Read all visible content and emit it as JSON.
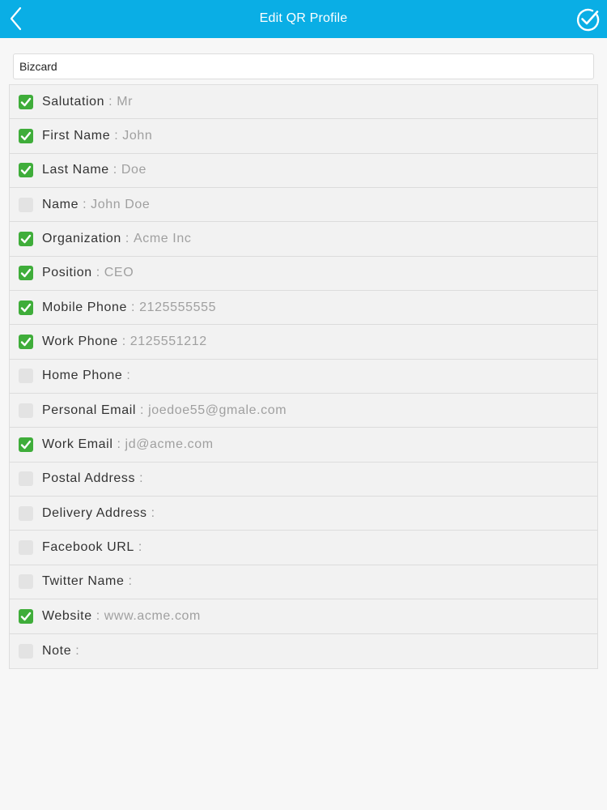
{
  "header": {
    "title": "Edit QR Profile",
    "back_icon": "chevron-left-icon",
    "done_icon": "check-circle-icon"
  },
  "profile_name": {
    "value": "Bizcard"
  },
  "colors": {
    "header": "#0aaee5",
    "checked": "#3fad3a",
    "unchecked": "#e3e3e3"
  },
  "fields": [
    {
      "label": "Salutation",
      "separator": ":",
      "value": "Mr",
      "checked": true
    },
    {
      "label": "First Name",
      "separator": ":",
      "value": "John",
      "checked": true
    },
    {
      "label": "Last Name",
      "separator": ":",
      "value": "Doe",
      "checked": true
    },
    {
      "label": "Name",
      "separator": ":",
      "value": "John Doe",
      "checked": false
    },
    {
      "label": "Organization",
      "separator": ":",
      "value": "Acme Inc",
      "checked": true
    },
    {
      "label": "Position",
      "separator": ":",
      "value": "CEO",
      "checked": true
    },
    {
      "label": "Mobile Phone",
      "separator": ":",
      "value": "2125555555",
      "checked": true
    },
    {
      "label": "Work Phone",
      "separator": ":",
      "value": "2125551212",
      "checked": true
    },
    {
      "label": "Home Phone",
      "separator": ":",
      "value": "",
      "checked": false
    },
    {
      "label": "Personal Email",
      "separator": ":",
      "value": "joedoe55@gmale.com",
      "checked": false
    },
    {
      "label": "Work Email",
      "separator": ":",
      "value": "jd@acme.com",
      "checked": true
    },
    {
      "label": "Postal Address",
      "separator": ":",
      "value": "",
      "checked": false
    },
    {
      "label": "Delivery Address",
      "separator": ":",
      "value": "",
      "checked": false
    },
    {
      "label": "Facebook URL",
      "separator": ":",
      "value": "",
      "checked": false
    },
    {
      "label": "Twitter Name",
      "separator": ":",
      "value": "",
      "checked": false
    },
    {
      "label": "Website",
      "separator": ":",
      "value": "www.acme.com",
      "checked": true
    },
    {
      "label": "Note",
      "separator": ":",
      "value": "",
      "checked": false
    }
  ]
}
